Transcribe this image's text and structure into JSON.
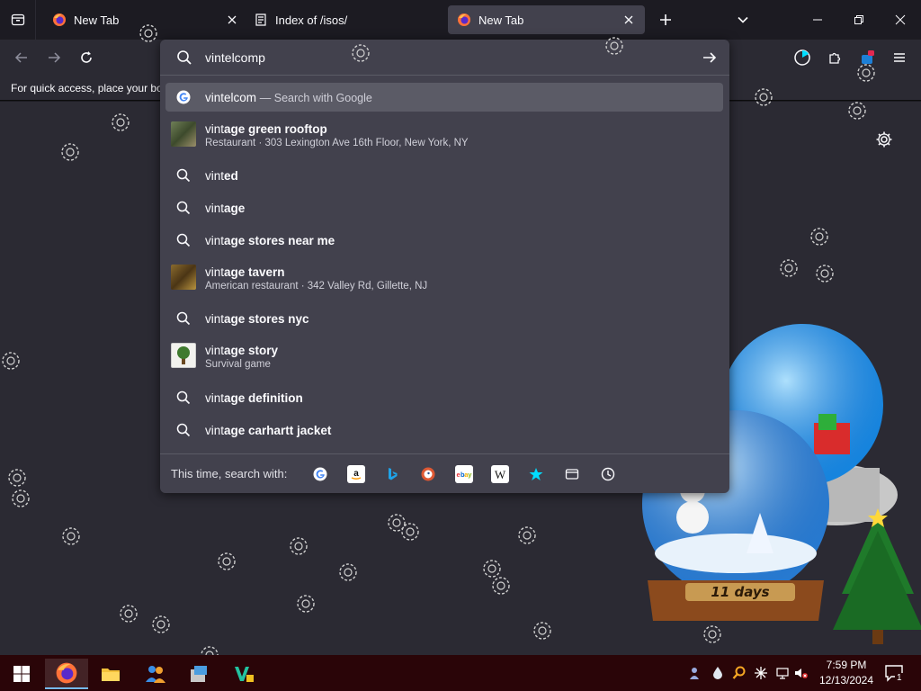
{
  "browser": {
    "tabs": [
      {
        "title": "New Tab",
        "active": false
      },
      {
        "title": "Index of /isos/",
        "active": false
      },
      {
        "title": "New Tab",
        "active": true
      }
    ],
    "bookmarks_hint": "For quick access, place your bo"
  },
  "urlbar": {
    "value": "vintelcomp"
  },
  "suggestions": [
    {
      "type": "search-engine",
      "text": "vintelcom",
      "suffix": "— Search with Google",
      "selected": true
    },
    {
      "type": "place",
      "prefix": "vint",
      "bold": "age green rooftop",
      "sub": "Restaurant · 303 Lexington Ave 16th Floor, New York, NY"
    },
    {
      "type": "search",
      "prefix": "vint",
      "bold": "ed"
    },
    {
      "type": "search",
      "prefix": "vint",
      "bold": "age"
    },
    {
      "type": "search",
      "prefix": "vint",
      "bold": "age stores near me"
    },
    {
      "type": "place",
      "prefix": "vint",
      "bold": "age tavern",
      "sub": "American restaurant · 342 Valley Rd, Gillette, NJ"
    },
    {
      "type": "search",
      "prefix": "vint",
      "bold": "age stores nyc"
    },
    {
      "type": "place",
      "prefix": "vint",
      "bold": "age story",
      "sub": "Survival game"
    },
    {
      "type": "search",
      "prefix": "vint",
      "bold": "age definition"
    },
    {
      "type": "search",
      "prefix": "vint",
      "bold": "age carhartt jacket"
    }
  ],
  "one_off": {
    "label": "This time, search with:",
    "engines": [
      "google-icon",
      "amazon-icon",
      "bing-icon",
      "duckduckgo-icon",
      "ebay-icon",
      "wikipedia-icon",
      "bookmarks-icon",
      "tabs-icon",
      "history-icon"
    ]
  },
  "decoration": {
    "countdown": "11 days"
  },
  "taskbar": {
    "time": "7:59 PM",
    "date": "12/13/2024",
    "notification_count": "1"
  },
  "colors": {
    "accent": "#00ddff",
    "taskbar": "#2a0508"
  }
}
